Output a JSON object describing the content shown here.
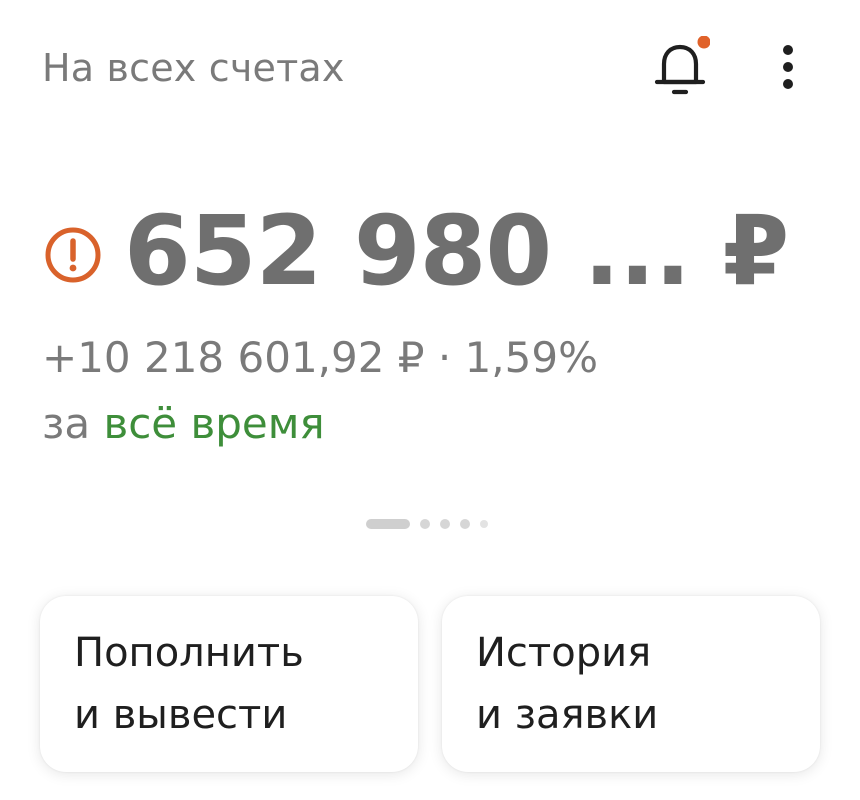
{
  "header": {
    "title": "На всех счетах",
    "notification_dot_color": "#e0622a"
  },
  "balance": {
    "amount": "652 980 ... ₽",
    "warning_icon": "warning-circle-icon",
    "warning_color": "#d9622b"
  },
  "profit": {
    "text": "+10 218 601,92 ₽ · 1,59%",
    "period_prefix": "за",
    "period_link": "всё время",
    "period_color": "#3e8e3a"
  },
  "pager": {
    "pages": 5,
    "active_index": 0
  },
  "actions": [
    {
      "line1": "Пополнить",
      "line2": "и вывести"
    },
    {
      "line1": "История",
      "line2": "и заявки"
    }
  ]
}
